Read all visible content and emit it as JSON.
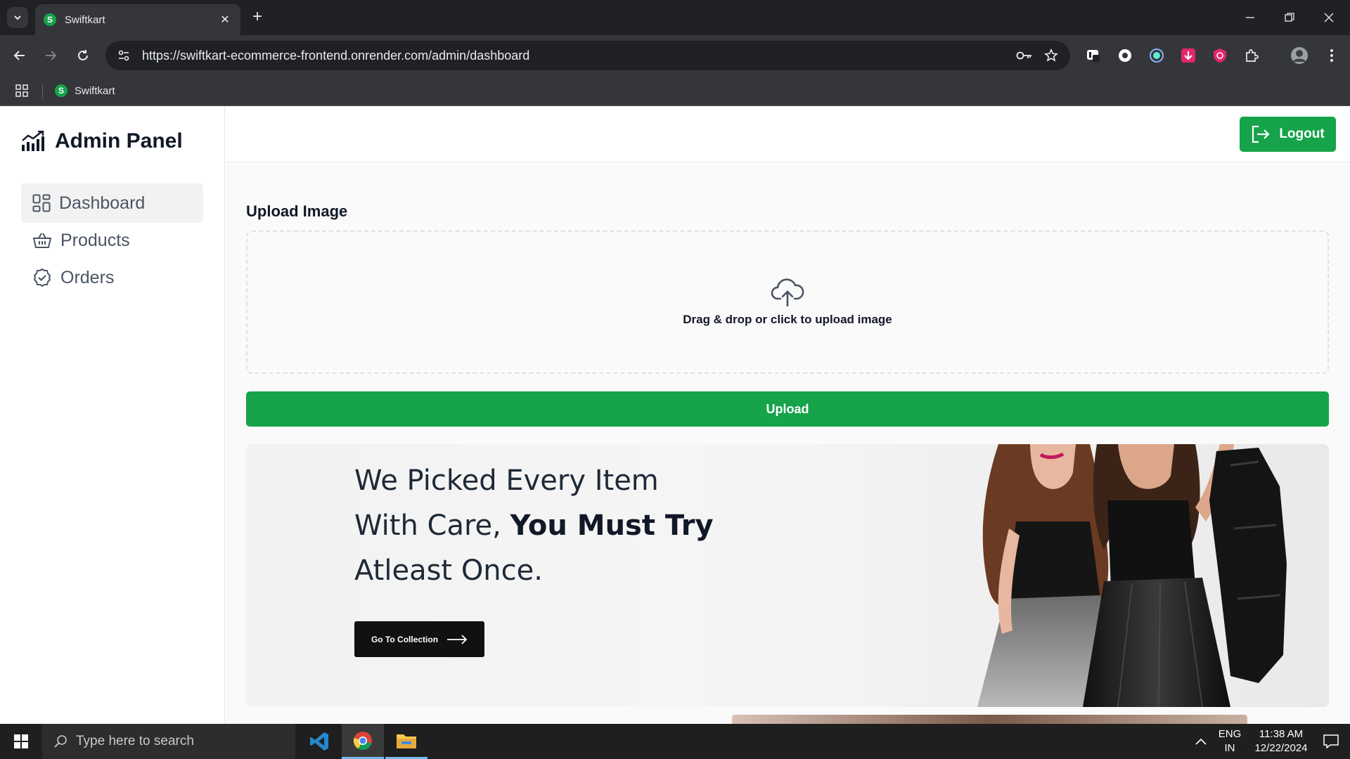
{
  "browser": {
    "tab_title": "Swiftkart",
    "tab_favicon_letter": "S",
    "url": "https://swiftkart-ecommerce-frontend.onrender.com/admin/dashboard",
    "bookmark_label": "Swiftkart",
    "bookmark_favicon_letter": "S"
  },
  "sidebar": {
    "brand_title": "Admin Panel",
    "items": [
      {
        "label": "Dashboard",
        "icon": "dashboard-grid-icon",
        "active": true
      },
      {
        "label": "Products",
        "icon": "basket-icon",
        "active": false
      },
      {
        "label": "Orders",
        "icon": "check-circle-icon",
        "active": false
      }
    ]
  },
  "header": {
    "logout_label": "Logout"
  },
  "upload": {
    "heading": "Upload Image",
    "dropzone_hint": "Drag & drop or click to upload image",
    "button_label": "Upload"
  },
  "hero": {
    "line1": "We Picked Every Item",
    "line2_prefix": "With Care, ",
    "line2_bold": "You Must Try",
    "line3": "Atleast Once.",
    "cta_label": "Go To Collection"
  },
  "taskbar": {
    "search_placeholder": "Type here to search",
    "lang_top": "ENG",
    "lang_bottom": "IN",
    "time": "11:38 AM",
    "date": "12/22/2024"
  },
  "colors": {
    "accent_green": "#16a34a",
    "dark": "#111111"
  }
}
